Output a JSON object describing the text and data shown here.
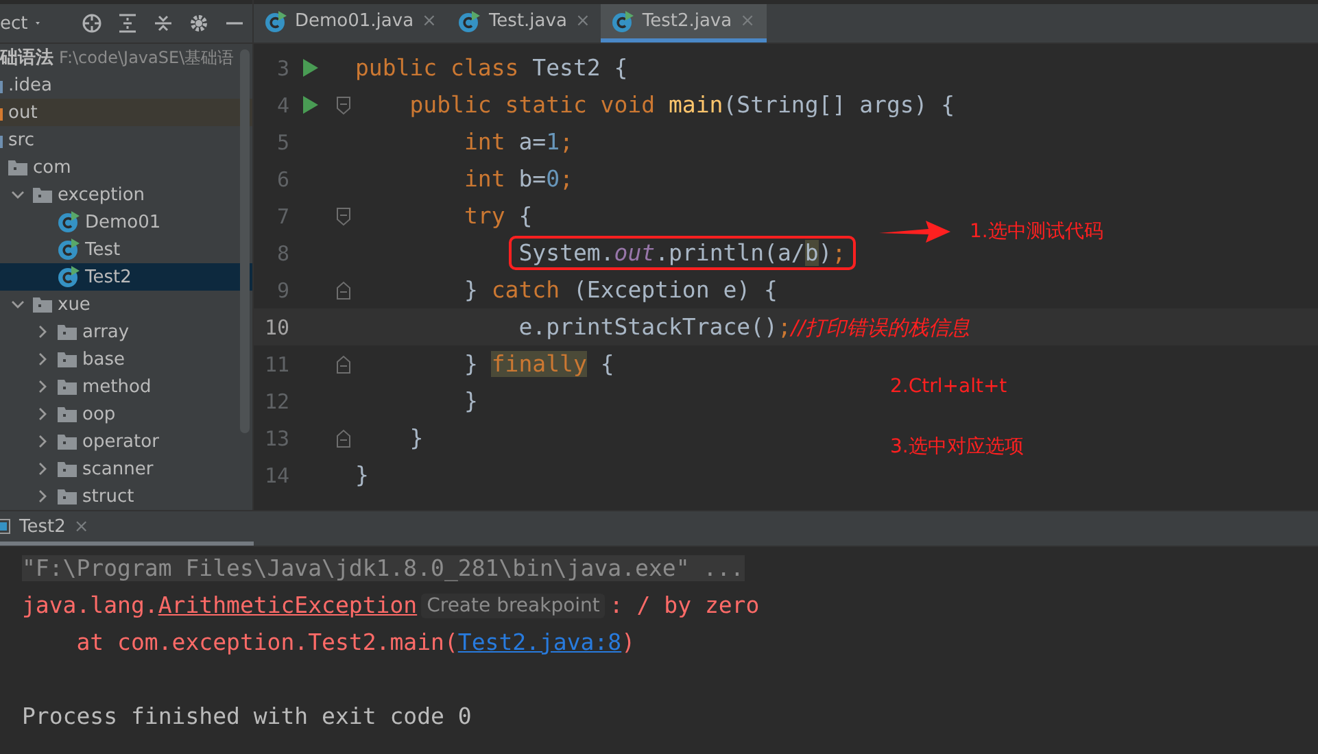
{
  "project_panel": {
    "title": "ect",
    "root": {
      "name": "础语法",
      "path": "F:\\code\\JavaSE\\基础语"
    },
    "items": [
      {
        "label": ".idea",
        "kind": "folder",
        "selected": false,
        "excluded": false
      },
      {
        "label": "out",
        "kind": "folder",
        "selected": false,
        "excluded": true
      },
      {
        "label": "src",
        "kind": "folder",
        "selected": false,
        "excluded": false,
        "children": [
          {
            "label": "com",
            "kind": "package",
            "selected": false,
            "excluded": false,
            "children": [
              {
                "label": "exception",
                "kind": "package",
                "expanded": true,
                "selected": false,
                "excluded": false,
                "children": [
                  {
                    "label": "Demo01",
                    "kind": "class",
                    "selected": false,
                    "excluded": false
                  },
                  {
                    "label": "Test",
                    "kind": "class",
                    "selected": false,
                    "excluded": false
                  },
                  {
                    "label": "Test2",
                    "kind": "class",
                    "selected": true,
                    "excluded": false
                  }
                ]
              },
              {
                "label": "xue",
                "kind": "package",
                "expanded": true,
                "selected": false,
                "excluded": false,
                "children": [
                  {
                    "label": "array",
                    "kind": "package",
                    "expanded": false,
                    "selected": false,
                    "excluded": false
                  },
                  {
                    "label": "base",
                    "kind": "package",
                    "expanded": false,
                    "selected": false,
                    "excluded": false
                  },
                  {
                    "label": "method",
                    "kind": "package",
                    "expanded": false,
                    "selected": false,
                    "excluded": false
                  },
                  {
                    "label": "oop",
                    "kind": "package",
                    "expanded": false,
                    "selected": false,
                    "excluded": false
                  },
                  {
                    "label": "operator",
                    "kind": "package",
                    "expanded": false,
                    "selected": false,
                    "excluded": false
                  },
                  {
                    "label": "scanner",
                    "kind": "package",
                    "expanded": false,
                    "selected": false,
                    "excluded": false
                  },
                  {
                    "label": "struct",
                    "kind": "package",
                    "expanded": false,
                    "selected": false,
                    "excluded": false
                  }
                ]
              }
            ]
          }
        ]
      }
    ]
  },
  "editor_tabs": [
    {
      "label": "Demo01.java",
      "selected": false,
      "close": "×"
    },
    {
      "label": "Test.java",
      "selected": false,
      "close": "×"
    },
    {
      "label": "Test2.java",
      "selected": true,
      "close": "×"
    }
  ],
  "code_lines": [
    {
      "number": "3",
      "run": true,
      "fold_start": false,
      "fold_end": false,
      "current": false,
      "boxed": false,
      "tokens": [
        {
          "text": "public class ",
          "kind": "keyword"
        },
        {
          "text": "Test2 {",
          "kind": "plain"
        }
      ]
    },
    {
      "number": "4",
      "run": true,
      "fold_start": true,
      "fold_end": false,
      "current": false,
      "boxed": false,
      "tokens": [
        {
          "text": "    public static void ",
          "kind": "keyword"
        },
        {
          "text": "main",
          "kind": "method"
        },
        {
          "text": "(String[] args) {",
          "kind": "plain"
        }
      ]
    },
    {
      "number": "5",
      "run": false,
      "fold_start": false,
      "fold_end": false,
      "current": false,
      "boxed": false,
      "tokens": [
        {
          "text": "        int ",
          "kind": "keyword"
        },
        {
          "text": "a=",
          "kind": "plain"
        },
        {
          "text": "1",
          "kind": "number"
        },
        {
          "text": ";",
          "kind": "keyword"
        }
      ]
    },
    {
      "number": "6",
      "run": false,
      "fold_start": false,
      "fold_end": false,
      "current": false,
      "boxed": false,
      "tokens": [
        {
          "text": "        int ",
          "kind": "keyword"
        },
        {
          "text": "b=",
          "kind": "plain"
        },
        {
          "text": "0",
          "kind": "number"
        },
        {
          "text": ";",
          "kind": "keyword"
        }
      ]
    },
    {
      "number": "7",
      "run": false,
      "fold_start": true,
      "fold_end": false,
      "current": false,
      "boxed": false,
      "tokens": [
        {
          "text": "        try ",
          "kind": "keyword"
        },
        {
          "text": "{",
          "kind": "plain"
        }
      ]
    },
    {
      "number": "8",
      "run": false,
      "fold_start": false,
      "fold_end": false,
      "current": false,
      "boxed": true,
      "tokens": [
        {
          "text": "            System.",
          "kind": "plain"
        },
        {
          "text": "out",
          "kind": "field"
        },
        {
          "text": ".println(a/",
          "kind": "plain"
        },
        {
          "text": "b",
          "kind": "match"
        },
        {
          "text": ")",
          "kind": "plain"
        },
        {
          "text": ";",
          "kind": "keyword"
        }
      ]
    },
    {
      "number": "9",
      "run": false,
      "fold_start": false,
      "fold_end": true,
      "current": false,
      "boxed": false,
      "tokens": [
        {
          "text": "        } ",
          "kind": "plain"
        },
        {
          "text": "catch ",
          "kind": "keyword"
        },
        {
          "text": "(Exception e) {",
          "kind": "plain"
        }
      ]
    },
    {
      "number": "10",
      "run": false,
      "fold_start": false,
      "fold_end": false,
      "current": true,
      "boxed": false,
      "tokens": [
        {
          "text": "            e.printStackTrace()",
          "kind": "plain"
        },
        {
          "text": ";",
          "kind": "keyword"
        },
        {
          "text": "//打印错误的栈信息",
          "kind": "comment"
        }
      ]
    },
    {
      "number": "11",
      "run": false,
      "fold_start": false,
      "fold_end": true,
      "current": false,
      "boxed": false,
      "tokens": [
        {
          "text": "        } ",
          "kind": "plain"
        },
        {
          "text": "finally",
          "kind": "usage"
        },
        {
          "text": " {",
          "kind": "plain"
        }
      ]
    },
    {
      "number": "12",
      "run": false,
      "fold_start": false,
      "fold_end": false,
      "current": false,
      "boxed": false,
      "tokens": [
        {
          "text": "        }",
          "kind": "plain"
        }
      ]
    },
    {
      "number": "13",
      "run": false,
      "fold_start": false,
      "fold_end": true,
      "current": false,
      "boxed": false,
      "tokens": [
        {
          "text": "    }",
          "kind": "plain"
        }
      ]
    },
    {
      "number": "14",
      "run": false,
      "fold_start": false,
      "fold_end": false,
      "current": false,
      "boxed": false,
      "tokens": [
        {
          "text": "}",
          "kind": "plain"
        }
      ]
    }
  ],
  "annotations": [
    {
      "text": "1.选中测试代码",
      "kind": "arrow"
    },
    {
      "text": "2.Ctrl+alt+t",
      "kind": "plain"
    },
    {
      "text": "3.选中对应选项",
      "kind": "plain"
    }
  ],
  "run_panel": {
    "tab": {
      "label": "Test2",
      "selected": true,
      "close": "×"
    },
    "lines": [
      {
        "kind": "command",
        "parts": [
          {
            "text": "\"F:\\Program Files\\Java\\jdk1.8.0_281\\bin\\java.exe\" ...",
            "kind": "text"
          }
        ]
      },
      {
        "kind": "error",
        "parts": [
          {
            "text": "java.lang.",
            "kind": "text"
          },
          {
            "text": "ArithmeticException",
            "kind": "class-link"
          },
          {
            "text": "Create breakpoint",
            "kind": "hint"
          },
          {
            "text": ": / by zero",
            "kind": "text"
          }
        ]
      },
      {
        "kind": "error",
        "parts": [
          {
            "text": "    at com.exception.Test2.main(",
            "kind": "text"
          },
          {
            "text": "Test2.java:8",
            "kind": "link"
          },
          {
            "text": ")",
            "kind": "text"
          }
        ]
      },
      {
        "kind": "blank"
      },
      {
        "kind": "normal",
        "parts": [
          {
            "text": "Process finished with exit code 0",
            "kind": "text"
          }
        ]
      }
    ]
  }
}
